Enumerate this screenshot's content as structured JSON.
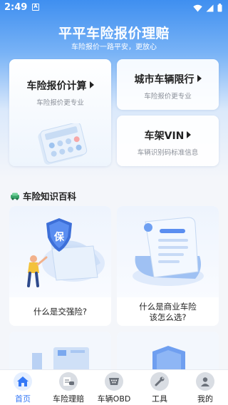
{
  "status_bar": {
    "time": "2:49",
    "notification_badge": "A"
  },
  "header": {
    "title": "平平车险报价理赔",
    "subtitle": "车险报价一路平安，更放心"
  },
  "cards": {
    "quote": {
      "title": "车险报价计算",
      "subtitle": "车险报价更专业"
    },
    "restriction": {
      "title": "城市车辆限行",
      "subtitle": "车险报价更专业"
    },
    "vin": {
      "title": "车架VIN",
      "subtitle": "车辆识别码标准信息"
    }
  },
  "knowledge": {
    "section_title": "车险知识百科",
    "articles": [
      {
        "line1": "什么是交强险?",
        "line2": "",
        "badge": "保"
      },
      {
        "line1": "什么是商业车险",
        "line2": "该怎么选?"
      },
      {
        "line1": "",
        "line2": ""
      },
      {
        "line1": "",
        "line2": ""
      }
    ]
  },
  "tabs": [
    {
      "label": "首页",
      "icon": "home-icon",
      "active": true
    },
    {
      "label": "车险理赔",
      "icon": "claim-icon",
      "active": false
    },
    {
      "label": "车辆OBD",
      "icon": "obd-icon",
      "active": false
    },
    {
      "label": "工具",
      "icon": "tools-icon",
      "active": false
    },
    {
      "label": "我的",
      "icon": "profile-icon",
      "active": false
    }
  ],
  "colors": {
    "accent": "#3478f6",
    "header_gradient_top": "#3f8ff0"
  }
}
